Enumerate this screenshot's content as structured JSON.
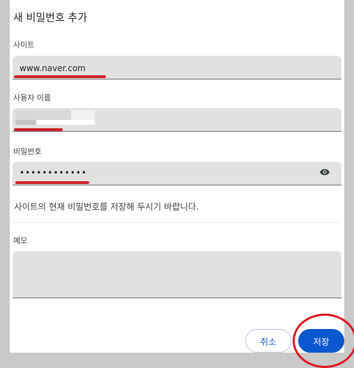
{
  "dialog": {
    "title": "새 비밀번호 추가",
    "site": {
      "label": "사이트",
      "value": "www.naver.com"
    },
    "username": {
      "label": "사용자 이름",
      "value": ""
    },
    "password": {
      "label": "비밀번호",
      "value": "••••••••••••",
      "toggle_icon": "eye-icon"
    },
    "description": "사이트의 현재 비밀번호를 저장해 두시기 바랍니다.",
    "memo": {
      "label": "메모",
      "value": ""
    },
    "buttons": {
      "cancel": "취소",
      "save": "저장"
    }
  },
  "colors": {
    "primary": "#0b57d0",
    "field_bg": "#e2e3e1",
    "annotation_red": "#d0202a"
  }
}
